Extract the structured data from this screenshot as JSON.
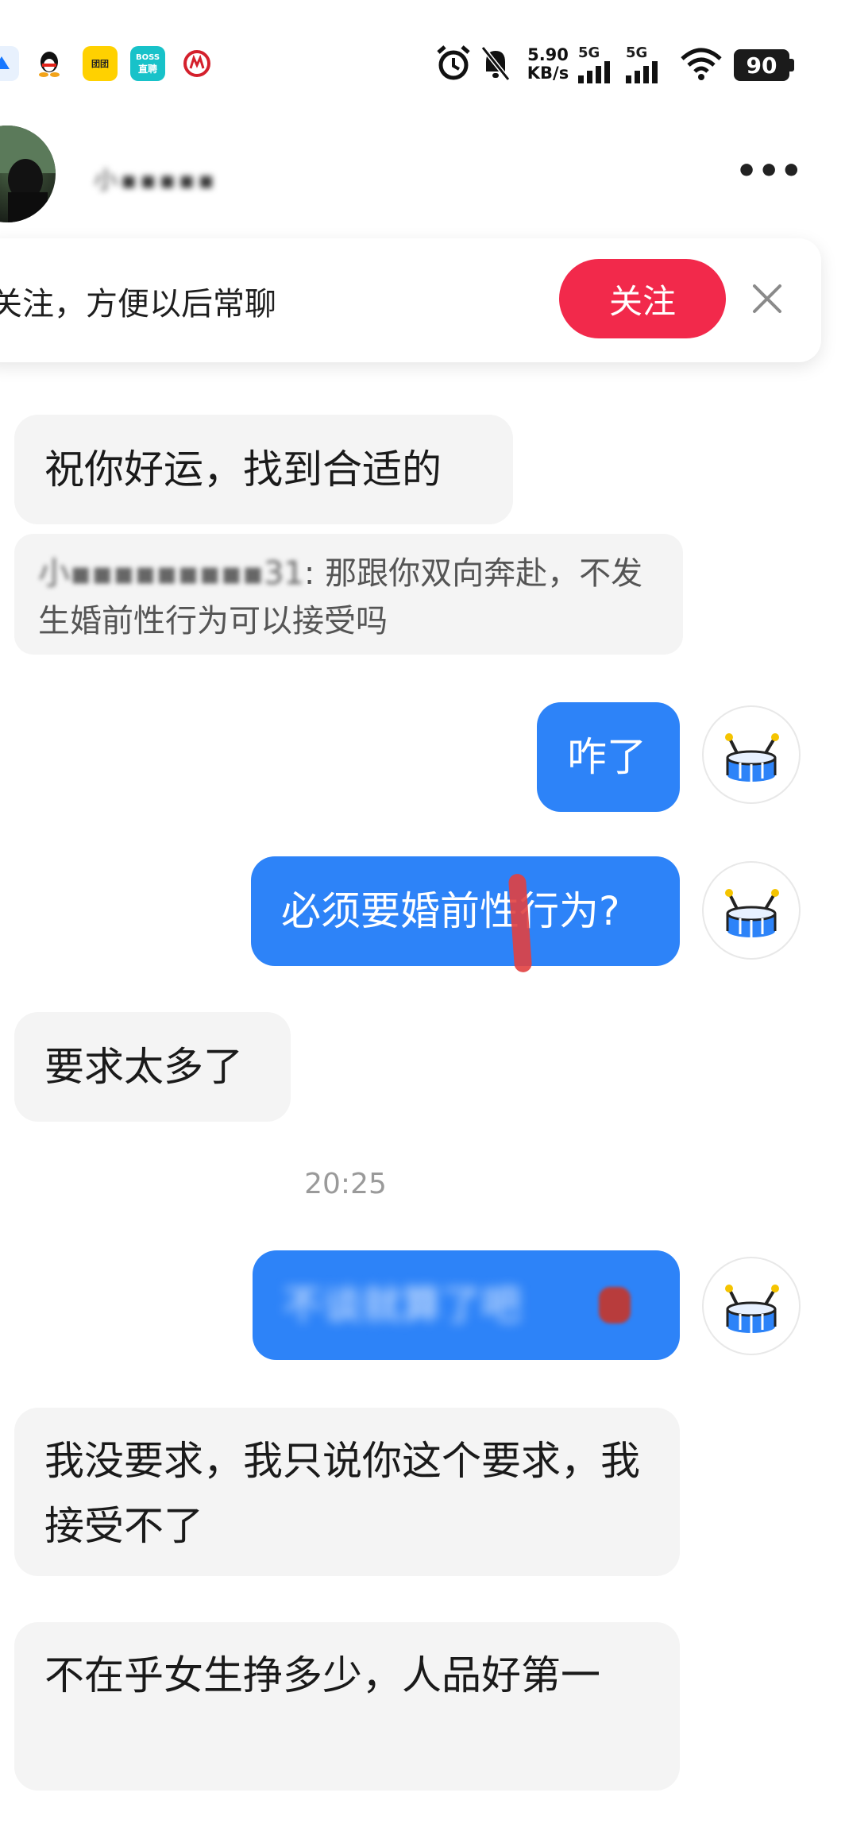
{
  "status_bar": {
    "apps": [
      "alipay",
      "qq",
      "meituan",
      "BOSS直聘",
      "china-merchants-bank"
    ],
    "boss_label_top": "BOSS",
    "boss_label_bottom": "直聘",
    "net_speed_value": "5.90",
    "net_speed_unit": "KB/s",
    "signal_1": "5G",
    "signal_2": "5G",
    "battery": "90"
  },
  "header": {
    "contact_name": "小▪▪▪▪▪",
    "more_label": "•••"
  },
  "follow_banner": {
    "text": "关注，方便以后常聊",
    "follow_label": "关注",
    "close_label": "×"
  },
  "messages": {
    "m1": "祝你好运，找到合适的",
    "quote_sender": "小▪▪▪▪▪▪▪▪▪31",
    "quote_text": ": 那跟你双向奔赴，不发生婚前性行为可以接受吗",
    "m2": "咋了",
    "m3": "必须要婚前性行为?",
    "m4": "要求太多了",
    "timestamp": "20:25",
    "m5": "不谈就算了吧",
    "m6": "我没要求，我只说你这个要求，我接受不了",
    "m7": "不在乎女生挣多少，人品好第一"
  },
  "colors": {
    "accent_blue": "#2d83f8",
    "follow_red": "#f2294b",
    "incoming_bg": "#f4f4f4"
  }
}
